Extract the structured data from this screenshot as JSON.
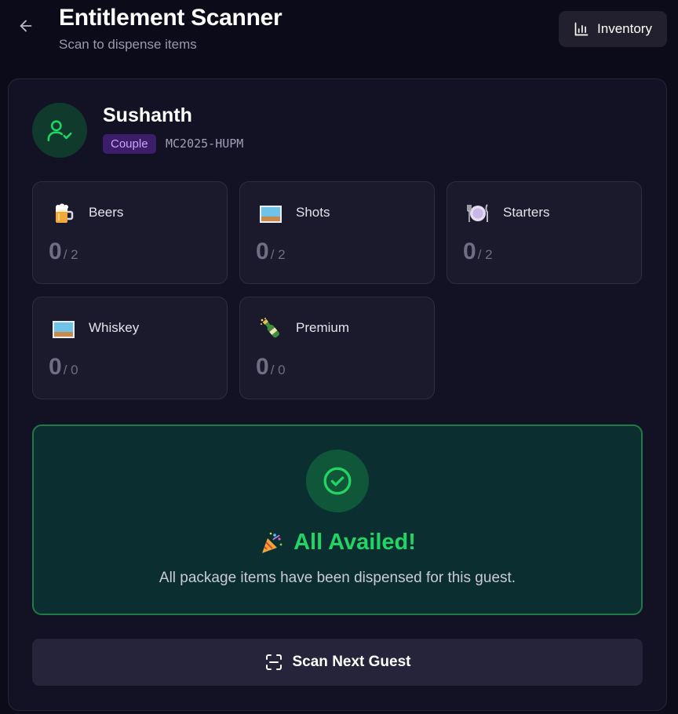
{
  "header": {
    "title": "Entitlement Scanner",
    "subtitle": "Scan to dispense items",
    "back_icon": "arrow-left-icon",
    "inventory_label": "Inventory",
    "inventory_icon": "bar-chart-icon"
  },
  "guest": {
    "name": "Sushanth",
    "badge": "Couple",
    "code": "MC2025-HUPM",
    "avatar_icon": "user-check-icon",
    "accent_color": "#22d463"
  },
  "entitlements": [
    {
      "label": "Beers",
      "icon": "beer-mug-icon",
      "used": "0",
      "total": "/ 2"
    },
    {
      "label": "Shots",
      "icon": "shot-glass-icon",
      "used": "0",
      "total": "/ 2"
    },
    {
      "label": "Starters",
      "icon": "plate-cutlery-icon",
      "used": "0",
      "total": "/ 2"
    },
    {
      "label": "Whiskey",
      "icon": "whiskey-glass-icon",
      "used": "0",
      "total": "/ 0"
    },
    {
      "label": "Premium",
      "icon": "champagne-bottle-icon",
      "used": "0",
      "total": "/ 0"
    }
  ],
  "status": {
    "icon": "check-circle-icon",
    "emoji_icon": "party-popper-icon",
    "title": "All Availed!",
    "message": "All package items have been dispensed for this guest.",
    "color": "#22d463"
  },
  "actions": {
    "scan_next_label": "Scan Next Guest",
    "scan_icon": "scan-icon"
  }
}
